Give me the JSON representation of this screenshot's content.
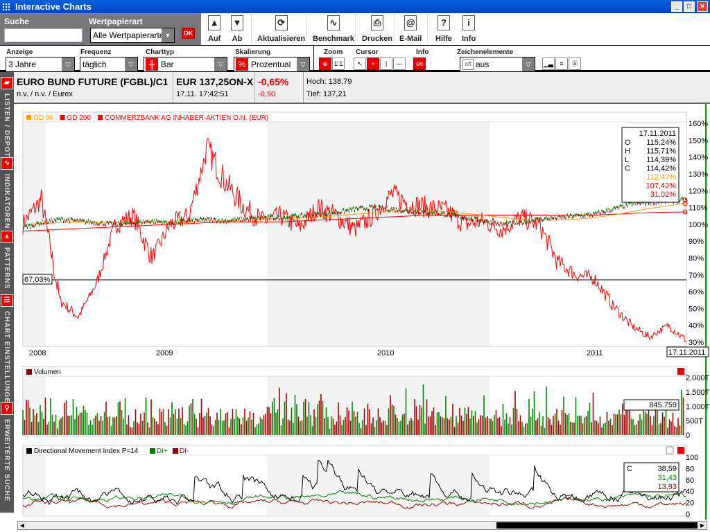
{
  "window": {
    "title": "Interactive Charts",
    "controls": [
      "_",
      "□",
      "×"
    ]
  },
  "search": {
    "label": "Suche",
    "value": "",
    "type_label": "Wertpapierart",
    "type_value": "Alle Wertpapierarten",
    "ok": "OK"
  },
  "toolbar": [
    {
      "label": "Auf",
      "icon": "▲"
    },
    {
      "label": "Ab",
      "icon": "▼"
    },
    {
      "label": "Aktualisieren",
      "icon": "⟳"
    },
    {
      "label": "Benchmark",
      "icon": "∿"
    },
    {
      "label": "Drucken",
      "icon": "⎙"
    },
    {
      "label": "E-Mail",
      "icon": "@"
    },
    {
      "label": "Hilfe",
      "icon": "?"
    },
    {
      "label": "Info",
      "icon": "i"
    }
  ],
  "settings": {
    "anzeige": {
      "label": "Anzeige",
      "value": "3 Jahre"
    },
    "frequenz": {
      "label": "Frequenz",
      "value": "täglich"
    },
    "charttyp": {
      "label": "Charttyp",
      "value": "Bar"
    },
    "skalierung": {
      "label": "Skalierung",
      "value": "Prozentual",
      "icon": "%"
    },
    "zoom": {
      "label": "Zoom",
      "reset": "1:1"
    },
    "cursor": {
      "label": "Cursor"
    },
    "info": {
      "label": "Info",
      "value": "on"
    },
    "zeichen": {
      "label": "Zeichenelemente",
      "value": "aus",
      "toggle": "off"
    }
  },
  "instrument": {
    "name": "EURO BUND FUTURE (FGBL)/C1",
    "sub": "n.v. / n.v. / Eurex",
    "price": "EUR 137,25ON-X",
    "time": "17.11. 17:42:51",
    "change_pct": "-0,65%",
    "change_abs": "-0,90",
    "high": "Hoch: 138,79",
    "low": "Tief: 137,21"
  },
  "sidebar": [
    {
      "label": "LISTEN / DEPOT"
    },
    {
      "label": "INDIKATOREN"
    },
    {
      "label": "PATTERNS"
    },
    {
      "label": "CHART EINSTELLUNGEN"
    },
    {
      "label": "ERWEITERTE SUCHE"
    }
  ],
  "chart_data": [
    {
      "type": "line",
      "legend": [
        "GD 90",
        "GD 200",
        "COMMERZBANK AG INHABER-AKTIEN O.N. (EUR)"
      ],
      "colors": {
        "bund_up": "#008000",
        "bund_down": "#990000",
        "gd90": "#ff9900",
        "gd200": "#ff0000",
        "commerzbank": "#ff0000"
      },
      "x_labels": [
        "2008",
        "2009",
        "2010",
        "2011"
      ],
      "x_range": [
        "17.11.2008",
        "17.11.2011"
      ],
      "cursor_date": "17.11.2011",
      "y_ticks": [
        "160%",
        "150%",
        "140%",
        "130%",
        "120%",
        "110%",
        "100%",
        "90%",
        "80%",
        "70%",
        "60%",
        "50%",
        "40%",
        "30%"
      ],
      "ylim": [
        30,
        160
      ],
      "hline": {
        "value": 67.03,
        "label": "67,03%"
      },
      "months": [
        "2008-11",
        "2008-12",
        "2009-01",
        "2009-02",
        "2009-03",
        "2009-04",
        "2009-05",
        "2009-06",
        "2009-07",
        "2009-08",
        "2009-09",
        "2009-10",
        "2009-11",
        "2009-12",
        "2010-01",
        "2010-02",
        "2010-03",
        "2010-04",
        "2010-05",
        "2010-06",
        "2010-07",
        "2010-08",
        "2010-09",
        "2010-10",
        "2010-11",
        "2010-12",
        "2011-01",
        "2011-02",
        "2011-03",
        "2011-04",
        "2011-05",
        "2011-06",
        "2011-07",
        "2011-08",
        "2011-09",
        "2011-10",
        "2011-11"
      ],
      "series": [
        {
          "name": "EURO BUND FUTURE (FGBL)/C1",
          "values": [
            98,
            101,
            103,
            102,
            101,
            100,
            101,
            102,
            101,
            102,
            103,
            102,
            103,
            104,
            104,
            105,
            106,
            107,
            109,
            110,
            109,
            108,
            107,
            106,
            104,
            102,
            100,
            101,
            103,
            104,
            105,
            106,
            109,
            112,
            113,
            114,
            114.42
          ]
        },
        {
          "name": "GD 90",
          "values": [
            100,
            100.5,
            101,
            101.5,
            101.5,
            101,
            101,
            101.5,
            101.5,
            101.5,
            102,
            102,
            102.5,
            103,
            103.5,
            104,
            104.5,
            105,
            106,
            107,
            108,
            108.5,
            108,
            107.5,
            106.5,
            105.5,
            104,
            103,
            102.5,
            102.5,
            103,
            104,
            105.5,
            107.5,
            109.5,
            111,
            112.47
          ]
        },
        {
          "name": "GD 200",
          "values": [
            96,
            96.5,
            97,
            97.5,
            98,
            98.5,
            99,
            99.5,
            100,
            100.5,
            101,
            101.5,
            101.5,
            101.5,
            101.5,
            102,
            102.5,
            103,
            103.5,
            104,
            104.5,
            105,
            105.5,
            105.5,
            105.5,
            105.5,
            105.5,
            105.5,
            105.5,
            105.5,
            105.5,
            105.5,
            106,
            106.5,
            107,
            107.2,
            107.42
          ]
        },
        {
          "name": "COMMERZBANK AG INHABER-AKTIEN O.N. (EUR)",
          "values": [
            100,
            115,
            55,
            45,
            65,
            100,
            105,
            80,
            100,
            105,
            145,
            125,
            110,
            102,
            105,
            98,
            110,
            105,
            97,
            105,
            118,
            112,
            110,
            108,
            100,
            102,
            97,
            104,
            100,
            78,
            70,
            68,
            52,
            40,
            33,
            40,
            31.02
          ]
        }
      ],
      "info_box": {
        "date": "17.11.2011",
        "rows": [
          {
            "k": "O",
            "v": "115,24%"
          },
          {
            "k": "H",
            "v": "115,71%"
          },
          {
            "k": "L",
            "v": "114,39%"
          },
          {
            "k": "C",
            "v": "114,42%"
          }
        ],
        "gd90": "112,47%",
        "gd200": "107,42%",
        "commerzbank": "31,02%"
      }
    },
    {
      "type": "bar",
      "title": "Volumen",
      "y_ticks": [
        "2.000T",
        "1.500T",
        "1.000T",
        "500T",
        "0"
      ],
      "ylim": [
        0,
        2000000
      ],
      "last_value": "845.759"
    },
    {
      "type": "line",
      "title": "Directional Movement Index P=14",
      "legend": [
        "DI+",
        "DI-"
      ],
      "colors": {
        "dmi": "#000000",
        "di_plus": "#008000",
        "di_minus": "#990000"
      },
      "y_ticks": [
        "100",
        "80",
        "60",
        "40",
        "20",
        "0"
      ],
      "ylim": [
        0,
        100
      ],
      "info_box": {
        "k": "C",
        "dmi": "38,59",
        "di_plus": "31,43",
        "di_minus": "13,93"
      }
    }
  ]
}
